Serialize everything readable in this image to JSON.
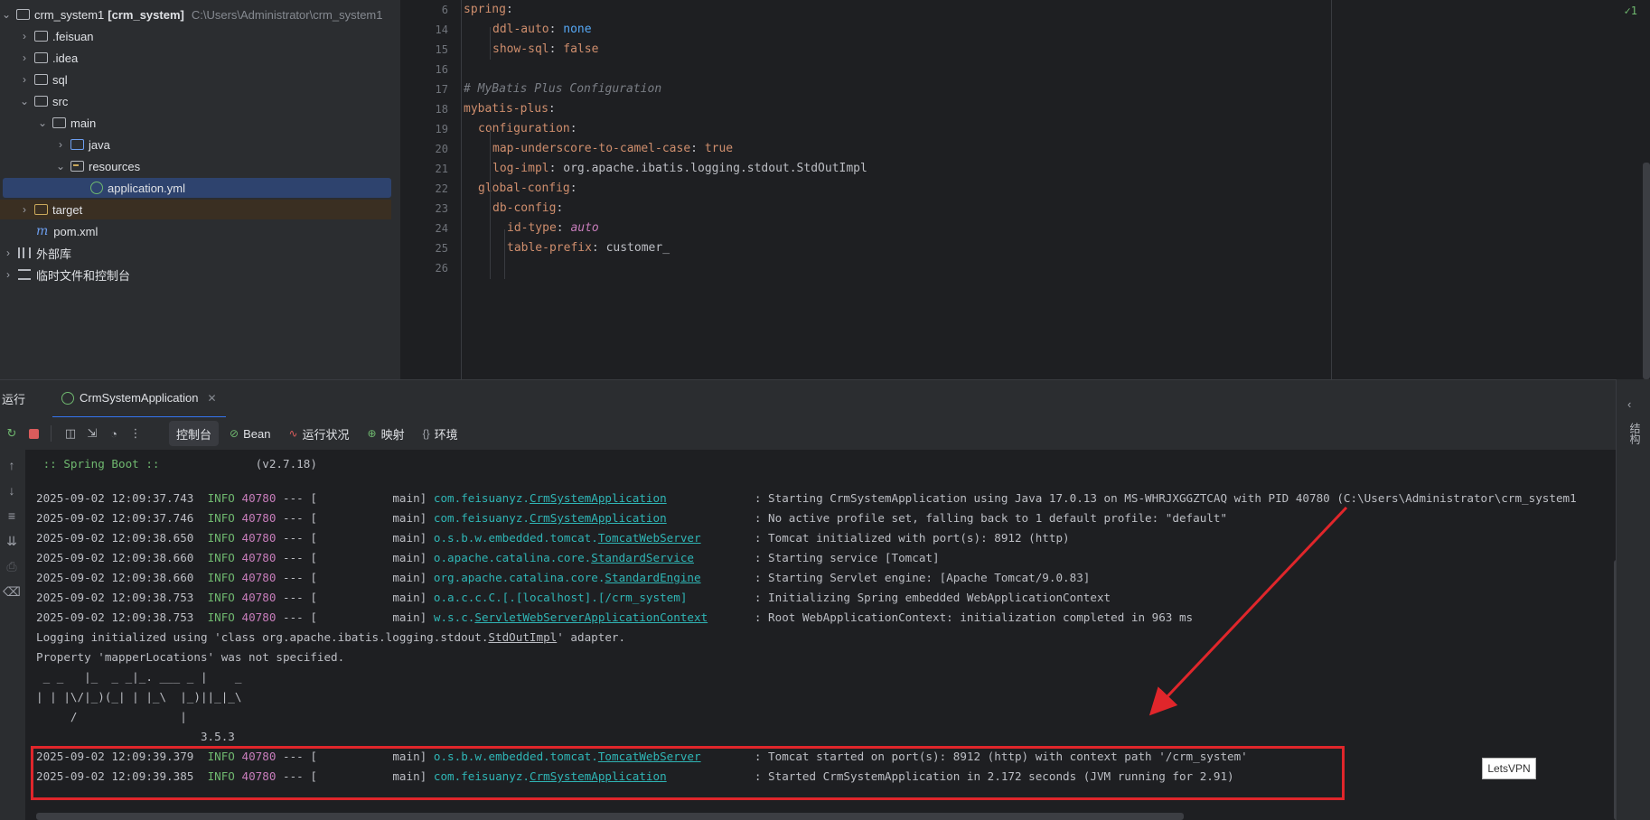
{
  "project": {
    "root_name": "crm_system1",
    "root_module": "[crm_system]",
    "root_path": "C:\\Users\\Administrator\\crm_system1",
    "items": [
      {
        "label": ".feisuan"
      },
      {
        "label": ".idea"
      },
      {
        "label": "sql"
      },
      {
        "label": "src"
      },
      {
        "label": "main"
      },
      {
        "label": "java"
      },
      {
        "label": "resources"
      },
      {
        "label": "application.yml"
      },
      {
        "label": "target"
      },
      {
        "label": "pom.xml"
      },
      {
        "label": "外部库"
      },
      {
        "label": "临时文件和控制台"
      }
    ]
  },
  "editor": {
    "inspection": "✓1",
    "lines": [
      {
        "num": "6",
        "parts": [
          "spring",
          ":"
        ]
      },
      {
        "num": "14",
        "parts": [
          "ddl-auto",
          ": ",
          "none"
        ]
      },
      {
        "num": "15",
        "parts": [
          "show-sql",
          ": ",
          "false"
        ]
      },
      {
        "num": "16",
        "parts": []
      },
      {
        "num": "17",
        "parts": [
          "# MyBatis Plus Configuration"
        ]
      },
      {
        "num": "18",
        "parts": [
          "mybatis-plus",
          ":"
        ]
      },
      {
        "num": "19",
        "parts": [
          "configuration",
          ":"
        ]
      },
      {
        "num": "20",
        "parts": [
          "map-underscore-to-camel-case",
          ": ",
          "true"
        ]
      },
      {
        "num": "21",
        "parts": [
          "log-impl",
          ": ",
          "org.apache.ibatis.logging.stdout.StdOutImpl"
        ]
      },
      {
        "num": "22",
        "parts": [
          "global-config",
          ":"
        ]
      },
      {
        "num": "23",
        "parts": [
          "db-config",
          ":"
        ]
      },
      {
        "num": "24",
        "parts": [
          "id-type",
          ": ",
          "auto"
        ]
      },
      {
        "num": "25",
        "parts": [
          "table-prefix",
          ": ",
          "customer_"
        ]
      },
      {
        "num": "26",
        "parts": []
      }
    ]
  },
  "run": {
    "title": "运行",
    "tab_label": "CrmSystemApplication",
    "subtabs": [
      "控制台",
      "Bean",
      "运行状况",
      "映射",
      "环境"
    ]
  },
  "console": {
    "spring_boot": ":: Spring Boot ::",
    "spring_version": "(v2.7.18)",
    "logs": [
      {
        "ts": "2025-09-02 12:09:37.743",
        "level": "INFO",
        "pid": "40780",
        "sep": "--- [",
        "thread": "main]",
        "logger_pre": "com.feisuanyz.",
        "logger_cls": "CrmSystemApplication",
        "msg": ": Starting CrmSystemApplication using Java 17.0.13 on MS-WHRJXGGZTCAQ with PID 40780 (C:\\Users\\Administrator\\crm_system1"
      },
      {
        "ts": "2025-09-02 12:09:37.746",
        "level": "INFO",
        "pid": "40780",
        "sep": "--- [",
        "thread": "main]",
        "logger_pre": "com.feisuanyz.",
        "logger_cls": "CrmSystemApplication",
        "msg": ": No active profile set, falling back to 1 default profile: \"default\""
      },
      {
        "ts": "2025-09-02 12:09:38.650",
        "level": "INFO",
        "pid": "40780",
        "sep": "--- [",
        "thread": "main]",
        "logger_pre": "o.s.b.w.embedded.tomcat.",
        "logger_cls": "TomcatWebServer",
        "msg": ": Tomcat initialized with port(s): 8912 (http)"
      },
      {
        "ts": "2025-09-02 12:09:38.660",
        "level": "INFO",
        "pid": "40780",
        "sep": "--- [",
        "thread": "main]",
        "logger_pre": "o.apache.catalina.core.",
        "logger_cls": "StandardService",
        "msg": ": Starting service [Tomcat]"
      },
      {
        "ts": "2025-09-02 12:09:38.660",
        "level": "INFO",
        "pid": "40780",
        "sep": "--- [",
        "thread": "main]",
        "logger_pre": "org.apache.catalina.core.",
        "logger_cls": "StandardEngine",
        "msg": ": Starting Servlet engine: [Apache Tomcat/9.0.83]"
      },
      {
        "ts": "2025-09-02 12:09:38.753",
        "level": "INFO",
        "pid": "40780",
        "sep": "--- [",
        "thread": "main]",
        "logger_pre": "o.a.c.c.C.[.[localhost].[/crm_system]",
        "logger_cls": "",
        "msg": ": Initializing Spring embedded WebApplicationContext"
      },
      {
        "ts": "2025-09-02 12:09:38.753",
        "level": "INFO",
        "pid": "40780",
        "sep": "--- [",
        "thread": "main]",
        "logger_pre": "w.s.c.",
        "logger_cls": "ServletWebServerApplicationContext",
        "msg": ": Root WebApplicationContext: initialization completed in 963 ms"
      }
    ],
    "plain1_a": "Logging initialized using 'class org.apache.ibatis.logging.stdout.",
    "plain1_b": "StdOutImpl",
    "plain1_c": "' adapter.",
    "plain2": "Property 'mapperLocations' was not specified.",
    "banner1": " _ _   |_  _ _|_. ___ _ |    _",
    "banner2": "| | |\\/|_)(_| | |_\\  |_)||_|_\\",
    "banner3": "     /               |",
    "banner4": "                        3.5.3",
    "final_logs": [
      {
        "ts": "2025-09-02 12:09:39.379",
        "level": "INFO",
        "pid": "40780",
        "sep": "--- [",
        "thread": "main]",
        "logger_pre": "o.s.b.w.embedded.tomcat.",
        "logger_cls": "TomcatWebServer",
        "msg": ": Tomcat started on port(s): 8912 (http) with context path '/crm_system'"
      },
      {
        "ts": "2025-09-02 12:09:39.385",
        "level": "INFO",
        "pid": "40780",
        "sep": "--- [",
        "thread": "main]",
        "logger_pre": "com.feisuanyz.",
        "logger_cls": "CrmSystemApplication",
        "msg": ": Started CrmSystemApplication in 2.172 seconds (JVM running for 2.91)"
      }
    ]
  },
  "right_strip": {
    "label": "结构"
  },
  "overlay": {
    "vpn_label": "LetsVPN"
  },
  "colors": {
    "highlight": "#e0262b",
    "accent": "#3574f0"
  }
}
